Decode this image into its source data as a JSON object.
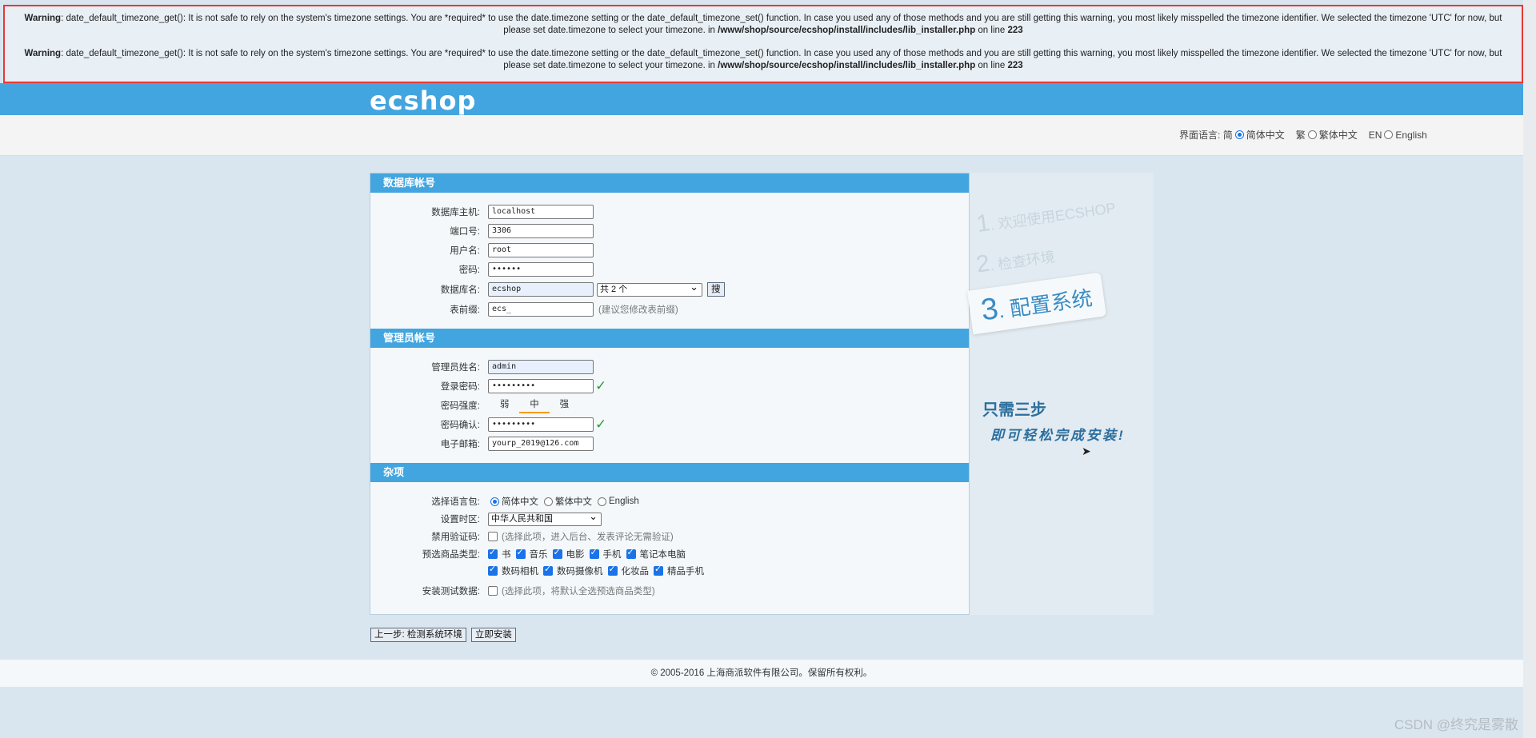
{
  "warnings": [
    {
      "label": "Warning",
      "message": ": date_default_timezone_get(): It is not safe to rely on the system's timezone settings. You are *required* to use the date.timezone setting or the date_default_timezone_set() function. In case you used any of those methods and you are still getting this warning, you most likely misspelled the timezone identifier. We selected the timezone 'UTC' for now, but please set date.timezone to select your timezone. in ",
      "file": "/www/shop/source/ecshop/install/includes/lib_installer.php",
      "line_text": " on line ",
      "line_no": "223"
    },
    {
      "label": "Warning",
      "message": ": date_default_timezone_get(): It is not safe to rely on the system's timezone settings. You are *required* to use the date.timezone setting or the date_default_timezone_set() function. In case you used any of those methods and you are still getting this warning, you most likely misspelled the timezone identifier. We selected the timezone 'UTC' for now, but please set date.timezone to select your timezone. in ",
      "file": "/www/shop/source/ecshop/install/includes/lib_installer.php",
      "line_text": " on line ",
      "line_no": "223"
    }
  ],
  "header": {
    "logo": "ecshop"
  },
  "lang_bar": {
    "label": "界面语言:",
    "options": [
      {
        "prefix": "简",
        "label": "简体中文",
        "selected": true
      },
      {
        "prefix": "繁",
        "label": "繁体中文",
        "selected": false
      },
      {
        "prefix": "EN",
        "label": "English",
        "selected": false
      }
    ]
  },
  "db_section": {
    "title": "数据库帐号",
    "host_label": "数据库主机:",
    "host_value": "localhost",
    "port_label": "端口号:",
    "port_value": "3306",
    "user_label": "用户名:",
    "user_value": "root",
    "pass_label": "密码:",
    "pass_value": "••••••",
    "dbname_label": "数据库名:",
    "dbname_value": "ecshop",
    "dbname_select": "共 2 个",
    "search_button": "搜",
    "prefix_label": "表前缀:",
    "prefix_value": "ecs_",
    "prefix_hint": "(建议您修改表前缀)"
  },
  "admin_section": {
    "title": "管理员帐号",
    "name_label": "管理员姓名:",
    "name_value": "admin",
    "pass_label": "登录密码:",
    "pass_value": "•••••••••",
    "strength_label": "密码强度:",
    "strength_levels": [
      "弱",
      "中",
      "强"
    ],
    "confirm_label": "密码确认:",
    "confirm_value": "•••••••••",
    "email_label": "电子邮箱:",
    "email_value": "yourp_2019@126.com"
  },
  "misc_section": {
    "title": "杂项",
    "lang_label": "选择语言包:",
    "lang_options": [
      {
        "label": "简体中文",
        "selected": true
      },
      {
        "label": "繁体中文",
        "selected": false
      },
      {
        "label": "English",
        "selected": false
      }
    ],
    "tz_label": "设置时区:",
    "tz_value": "中华人民共和国",
    "captcha_label": "禁用验证码:",
    "captcha_hint": "(选择此项，进入后台、发表评论无需验证)",
    "goods_label": "预选商品类型:",
    "goods_row1": [
      "书",
      "音乐",
      "电影",
      "手机",
      "笔记本电脑"
    ],
    "goods_row2": [
      "数码相机",
      "数码摄像机",
      "化妆品",
      "精品手机"
    ],
    "demo_label": "安装测试数据:",
    "demo_hint": "(选择此项，将默认全选预选商品类型)"
  },
  "steps": {
    "step1_num": "1",
    "step1": ". 欢迎使用ECSHOP",
    "step2_num": "2",
    "step2": ". 检查环境",
    "step3_num": "3",
    "step3": ". 配置系统",
    "promo1": "只需三步",
    "promo2": "即可轻松完成安装!"
  },
  "actions": {
    "prev": "上一步: 检测系统环境",
    "install": "立即安装"
  },
  "footer": "© 2005-2016 上海商派软件有限公司。保留所有权利。",
  "watermark": "CSDN @终究是雾散"
}
